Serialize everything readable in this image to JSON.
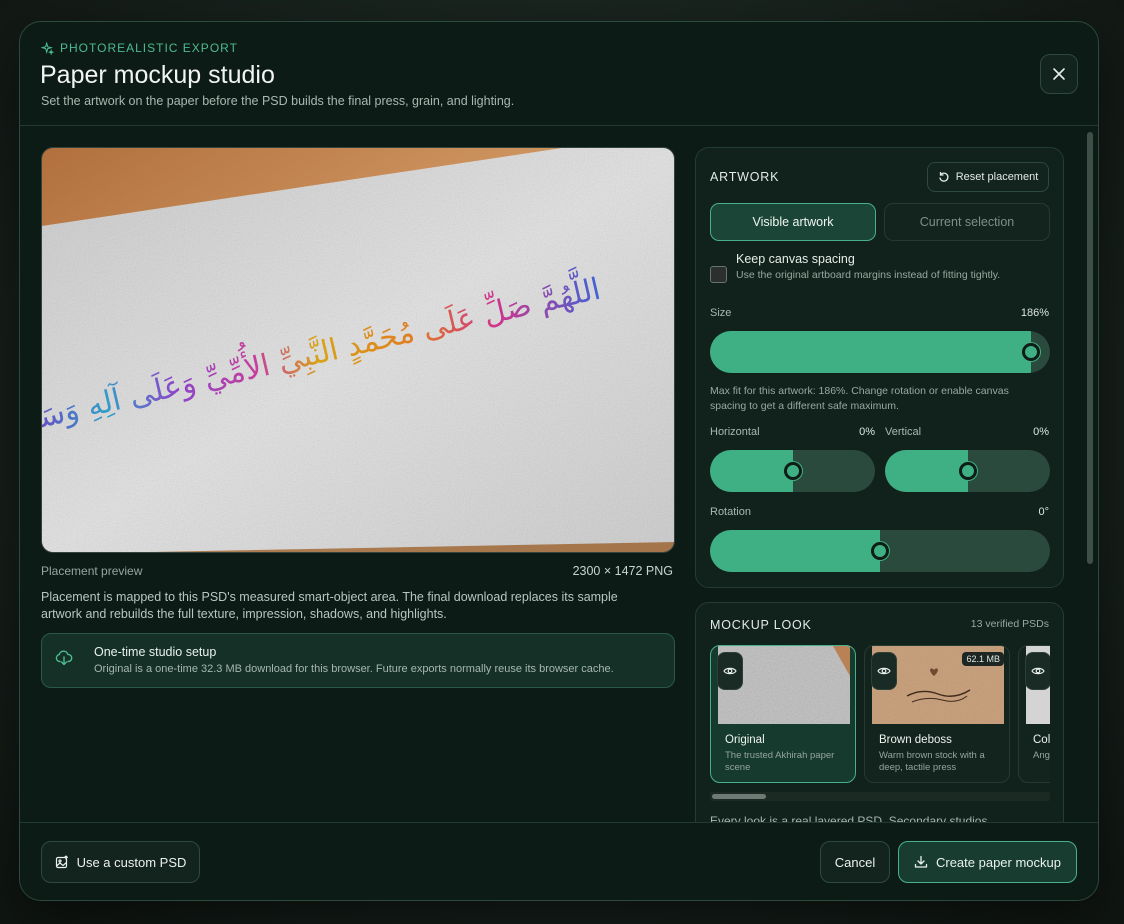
{
  "header": {
    "eyebrow": "PHOTOREALISTIC EXPORT",
    "title": "Paper mockup studio",
    "subtitle": "Set the artwork on the paper before the PSD builds the final press, grain, and lighting."
  },
  "preview": {
    "artwork_text": "اللَّهُمَّ صَلِّ عَلَى مُحَمَّدٍ النَّبِيِّ الأُمِّيِّ وَعَلَى آلِهِ وَسَلِّمْ",
    "label": "Placement preview",
    "size": "2300 × 1472 PNG",
    "description": "Placement is mapped to this PSD's measured smart-object area. The final download replaces its sample artwork and rebuilds the full texture, impression, shadows, and highlights."
  },
  "setup": {
    "title": "One-time studio setup",
    "text": "Original is a one-time 32.3 MB download for this browser. Future exports normally reuse its browser cache."
  },
  "artwork": {
    "heading": "ARTWORK",
    "reset_label": "Reset placement",
    "segments": [
      "Visible artwork",
      "Current selection"
    ],
    "keep_spacing_title": "Keep canvas spacing",
    "keep_spacing_sub": "Use the original artboard margins instead of fitting tightly.",
    "keep_spacing_checked": false,
    "size_label": "Size",
    "size_value": "186%",
    "size_fraction": 1.0,
    "hint": "Max fit for this artwork: 186%. Change rotation or enable canvas spacing to get a different safe maximum.",
    "horizontal_label": "Horizontal",
    "horizontal_value": "0%",
    "horizontal_fraction": 0.5,
    "vertical_label": "Vertical",
    "vertical_value": "0%",
    "vertical_fraction": 0.5,
    "rotation_label": "Rotation",
    "rotation_value": "0°",
    "rotation_fraction": 0.5
  },
  "mockup": {
    "heading": "MOCKUP LOOK",
    "verified": "13 verified PSDs",
    "cards": [
      {
        "name": "Original",
        "desc": "The trusted Akhirah paper scene",
        "selected": true
      },
      {
        "name": "Brown deboss",
        "desc": "Warm brown stock with a deep, tactile press",
        "badge": "62.1 MB"
      },
      {
        "name": "Col",
        "desc": "Ang with"
      }
    ],
    "more_text": "Every look is a real layered PSD. Secondary studios"
  },
  "footer": {
    "custom_psd": "Use a custom PSD",
    "cancel": "Cancel",
    "create": "Create paper mockup"
  },
  "colors": {
    "accent": "#3fb083",
    "background": "#0d1b16"
  }
}
